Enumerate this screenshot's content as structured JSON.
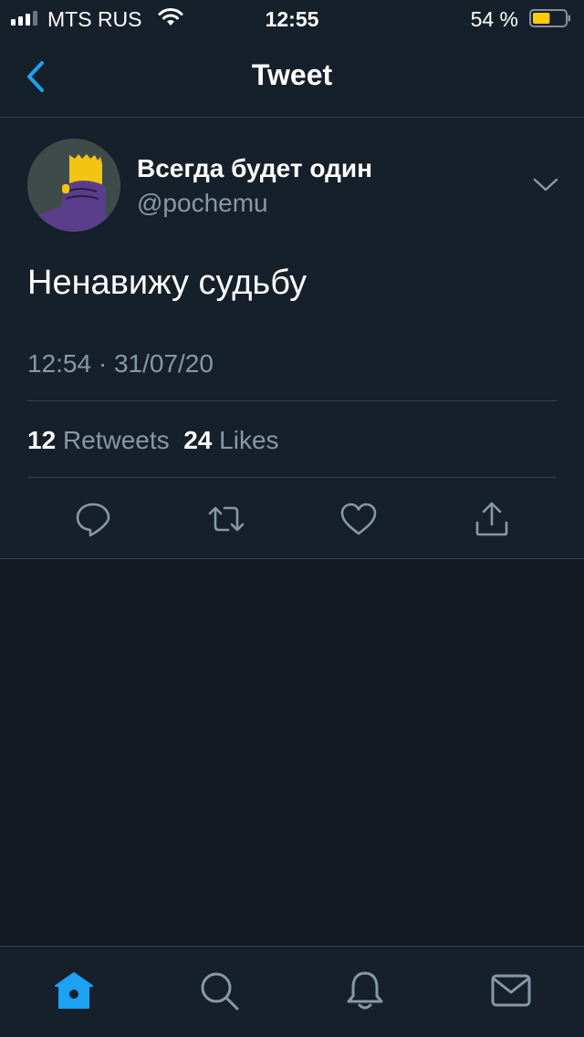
{
  "status_bar": {
    "carrier": "MTS RUS",
    "time": "12:55",
    "battery_percent": "54 %",
    "battery_level": 0.54,
    "signal_bars_filled": 3,
    "signal_bars_total": 4
  },
  "nav": {
    "title": "Tweet",
    "back_icon": "chevron-left-icon"
  },
  "tweet": {
    "display_name": "Всегда будет один",
    "handle": "@pochemu",
    "text": "Ненавижу судьбу",
    "timestamp": "12:54 · 31/07/20",
    "retweets_count": "12",
    "retweets_label": "Retweets",
    "likes_count": "24",
    "likes_label": "Likes",
    "actions": [
      "reply-icon",
      "retweet-icon",
      "like-icon",
      "share-icon"
    ]
  },
  "tab_bar": {
    "tabs": [
      "home-icon",
      "search-icon",
      "notifications-icon",
      "messages-icon"
    ],
    "active": "home-icon"
  },
  "colors": {
    "background": "#141923",
    "surface": "#15202b",
    "accent": "#1da1f2",
    "secondary_text": "#8899a6",
    "divider": "#38444d"
  }
}
